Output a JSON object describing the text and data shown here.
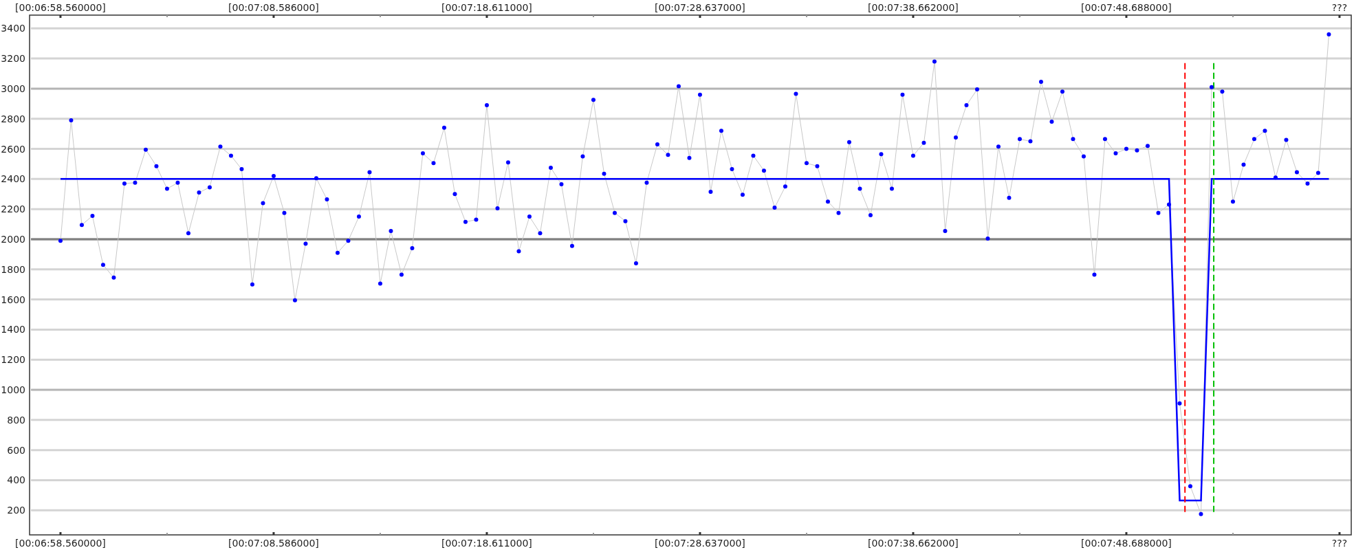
{
  "chart": {
    "chart_data": {
      "type": "line",
      "categories": [
        "[00:06:58.560000]",
        null,
        null,
        null,
        null,
        null,
        null,
        null,
        null,
        null,
        null,
        null,
        null,
        null,
        null,
        null,
        null,
        null,
        null,
        null,
        "[00:07:08.586000]",
        null,
        null,
        null,
        null,
        null,
        null,
        null,
        null,
        null,
        null,
        null,
        null,
        null,
        null,
        null,
        null,
        null,
        null,
        null,
        "[00:07:18.611000]",
        null,
        null,
        null,
        null,
        null,
        null,
        null,
        null,
        null,
        null,
        null,
        null,
        null,
        null,
        null,
        null,
        null,
        null,
        null,
        "[00:07:28.637000]",
        null,
        null,
        null,
        null,
        null,
        null,
        null,
        null,
        null,
        null,
        null,
        null,
        null,
        null,
        null,
        null,
        null,
        null,
        null,
        "[00:07:38.662000]",
        null,
        null,
        null,
        null,
        null,
        null,
        null,
        null,
        null,
        null,
        null,
        null,
        null,
        null,
        null,
        null,
        null,
        null,
        null,
        "[00:07:48.688000]",
        null,
        null,
        null,
        null,
        null,
        null,
        null,
        null,
        null,
        null,
        null,
        null,
        null,
        null,
        null,
        null,
        null,
        null,
        null,
        "???"
      ],
      "series": [
        {
          "color": "#c8c8c8",
          "marker": true,
          "values": [
            1990,
            2790,
            2095,
            2155,
            1830,
            1745,
            2370,
            2375,
            2595,
            2485,
            2335,
            2375,
            2040,
            2310,
            2345,
            2615,
            2555,
            2465,
            1700,
            2240,
            2420,
            2175,
            1595,
            1970,
            2405,
            2265,
            1910,
            1990,
            2150,
            2445,
            1705,
            2055,
            1765,
            1940,
            2570,
            2505,
            2740,
            2300,
            2115,
            2130,
            2890,
            2205,
            2510,
            1920,
            2150,
            2040,
            2475,
            2365,
            1955,
            2550,
            2925,
            2435,
            2175,
            2120,
            1840,
            2375,
            2630,
            2560,
            3015,
            2540,
            2960,
            2315,
            2720,
            2465,
            2295,
            2555,
            2455,
            2210,
            2350,
            2965,
            2505,
            2485,
            2250,
            2175,
            2645,
            2335,
            2160,
            2565,
            2335,
            2960,
            2555,
            2640,
            3180,
            2055,
            2675,
            2890,
            2995,
            2005,
            2615,
            2275,
            2665,
            2650,
            3045,
            2780,
            2980,
            2665,
            2550,
            1765,
            2665,
            2570,
            2600,
            2590,
            2620,
            2175,
            2230,
            910,
            360,
            175,
            3010,
            2980,
            2250,
            2495,
            2665,
            2720,
            2410,
            2660,
            2445,
            2370,
            2440,
            3360,
            null
          ]
        },
        {
          "color": "#0000ff",
          "values": [
            2400,
            2400,
            2400,
            2400,
            2400,
            2400,
            2400,
            2400,
            2400,
            2400,
            2400,
            2400,
            2400,
            2400,
            2400,
            2400,
            2400,
            2400,
            2400,
            2400,
            2400,
            2400,
            2400,
            2400,
            2400,
            2400,
            2400,
            2400,
            2400,
            2400,
            2400,
            2400,
            2400,
            2400,
            2400,
            2400,
            2400,
            2400,
            2400,
            2400,
            2400,
            2400,
            2400,
            2400,
            2400,
            2400,
            2400,
            2400,
            2400,
            2400,
            2400,
            2400,
            2400,
            2400,
            2400,
            2400,
            2400,
            2400,
            2400,
            2400,
            2400,
            2400,
            2400,
            2400,
            2400,
            2400,
            2400,
            2400,
            2400,
            2400,
            2400,
            2400,
            2400,
            2400,
            2400,
            2400,
            2400,
            2400,
            2400,
            2400,
            2400,
            2400,
            2400,
            2400,
            2400,
            2400,
            2400,
            2400,
            2400,
            2400,
            2400,
            2400,
            2400,
            2400,
            2400,
            2400,
            2400,
            2400,
            2400,
            2400,
            2400,
            2400,
            2400,
            2400,
            2400,
            265,
            265,
            265,
            2400,
            2400,
            2400,
            2400,
            2400,
            2400,
            2400,
            2400,
            2400,
            2400,
            2400,
            2400,
            null
          ]
        }
      ],
      "ylim": [
        37,
        3488
      ],
      "grid": true,
      "ref_lines": [
        {
          "axis": "y",
          "value": 2000,
          "color": "#808080"
        }
      ],
      "yticks": [
        200,
        400,
        600,
        800,
        1000,
        1200,
        1400,
        1600,
        1800,
        2000,
        2200,
        2400,
        2600,
        2800,
        3000,
        3200,
        3400
      ]
    }
  }
}
